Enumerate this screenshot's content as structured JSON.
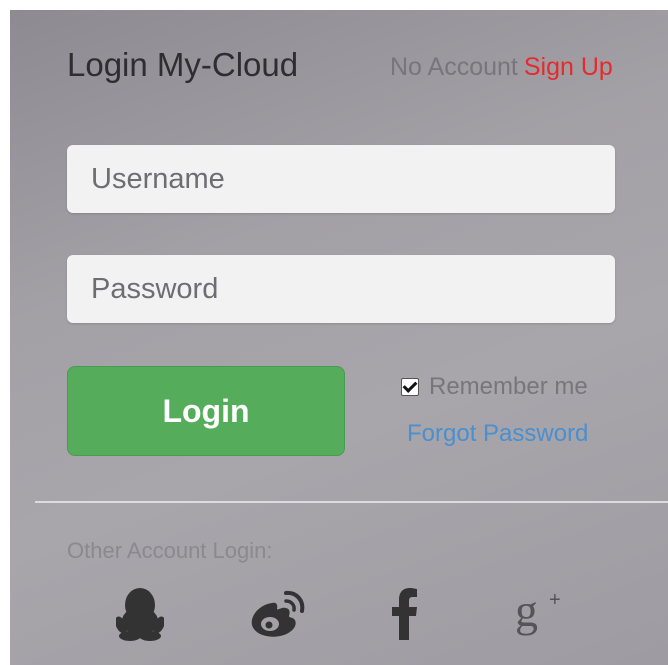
{
  "header": {
    "title": "Login My-Cloud",
    "no_account_text": "No Account",
    "signup_link": "Sign Up"
  },
  "form": {
    "username_placeholder": "Username",
    "password_placeholder": "Password",
    "login_button": "Login",
    "remember_label": "Remember me",
    "remember_checked": true,
    "forgot_link": "Forgot Password"
  },
  "social": {
    "label": "Other Account Login:",
    "items": [
      {
        "name": "qq",
        "icon": "qq-penguin-icon"
      },
      {
        "name": "weibo",
        "icon": "weibo-icon"
      },
      {
        "name": "facebook",
        "icon": "facebook-icon"
      },
      {
        "name": "google-plus",
        "icon": "google-plus-icon"
      }
    ]
  },
  "colors": {
    "accent_green": "#55ad5c",
    "signup_red": "#e52b2b",
    "link_blue": "#4a8fd0",
    "icon_dark": "#333333"
  }
}
